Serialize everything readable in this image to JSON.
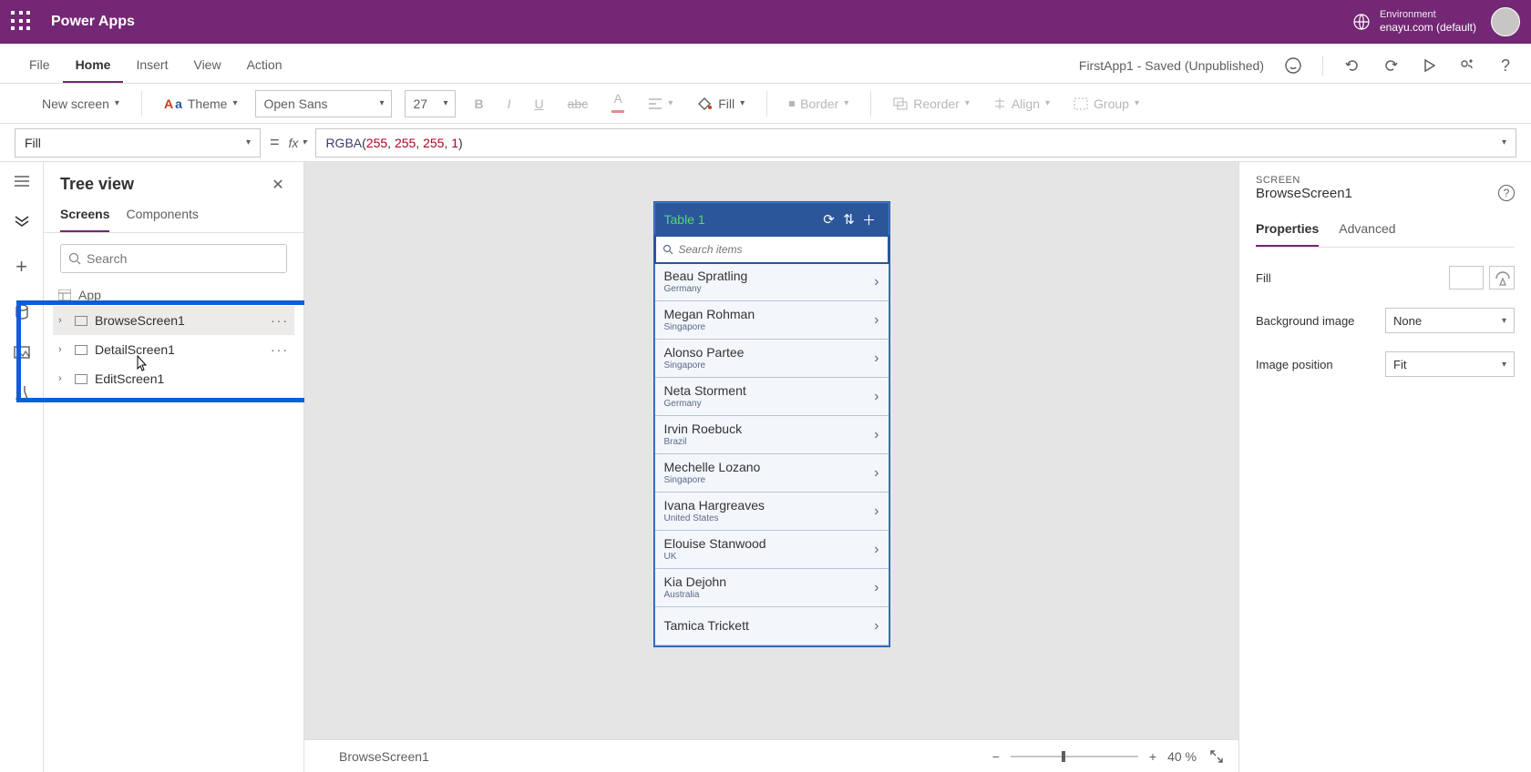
{
  "header": {
    "app": "Power Apps",
    "env_label": "Environment",
    "env_name": "enayu.com (default)"
  },
  "menu": {
    "tabs": [
      "File",
      "Home",
      "Insert",
      "View",
      "Action"
    ],
    "active": 1,
    "status": "FirstApp1 - Saved (Unpublished)"
  },
  "toolbar": {
    "new_screen": "New screen",
    "theme": "Theme",
    "font": "Open Sans",
    "font_size": "27",
    "fill": "Fill",
    "border": "Border",
    "reorder": "Reorder",
    "align": "Align",
    "group": "Group"
  },
  "formula": {
    "property": "Fill",
    "fx": "fx",
    "fn": "RGBA",
    "args": [
      "255",
      "255",
      "255",
      "1"
    ]
  },
  "tree": {
    "title": "Tree view",
    "tabs": [
      "Screens",
      "Components"
    ],
    "active": 0,
    "search_placeholder": "Search",
    "app": "App",
    "items": [
      {
        "name": "BrowseScreen1",
        "sel": true,
        "more": true
      },
      {
        "name": "DetailScreen1",
        "sel": false,
        "more": true
      },
      {
        "name": "EditScreen1",
        "sel": false,
        "more": false
      }
    ]
  },
  "phone": {
    "title": "Table 1",
    "search_placeholder": "Search items",
    "rows": [
      {
        "n": "Beau Spratling",
        "s": "Germany"
      },
      {
        "n": "Megan Rohman",
        "s": "Singapore"
      },
      {
        "n": "Alonso Partee",
        "s": "Singapore"
      },
      {
        "n": "Neta Storment",
        "s": "Germany"
      },
      {
        "n": "Irvin Roebuck",
        "s": "Brazil"
      },
      {
        "n": "Mechelle Lozano",
        "s": "Singapore"
      },
      {
        "n": "Ivana Hargreaves",
        "s": "United States"
      },
      {
        "n": "Elouise Stanwood",
        "s": "UK"
      },
      {
        "n": "Kia Dejohn",
        "s": "Australia"
      },
      {
        "n": "Tamica Trickett",
        "s": ""
      }
    ]
  },
  "status": {
    "screen": "BrowseScreen1",
    "zoom": "40",
    "pct": "%"
  },
  "props": {
    "section": "SCREEN",
    "name": "BrowseScreen1",
    "tabs": [
      "Properties",
      "Advanced"
    ],
    "active": 0,
    "rows": {
      "fill": "Fill",
      "bg": "Background image",
      "bg_val": "None",
      "pos": "Image position",
      "pos_val": "Fit"
    }
  }
}
